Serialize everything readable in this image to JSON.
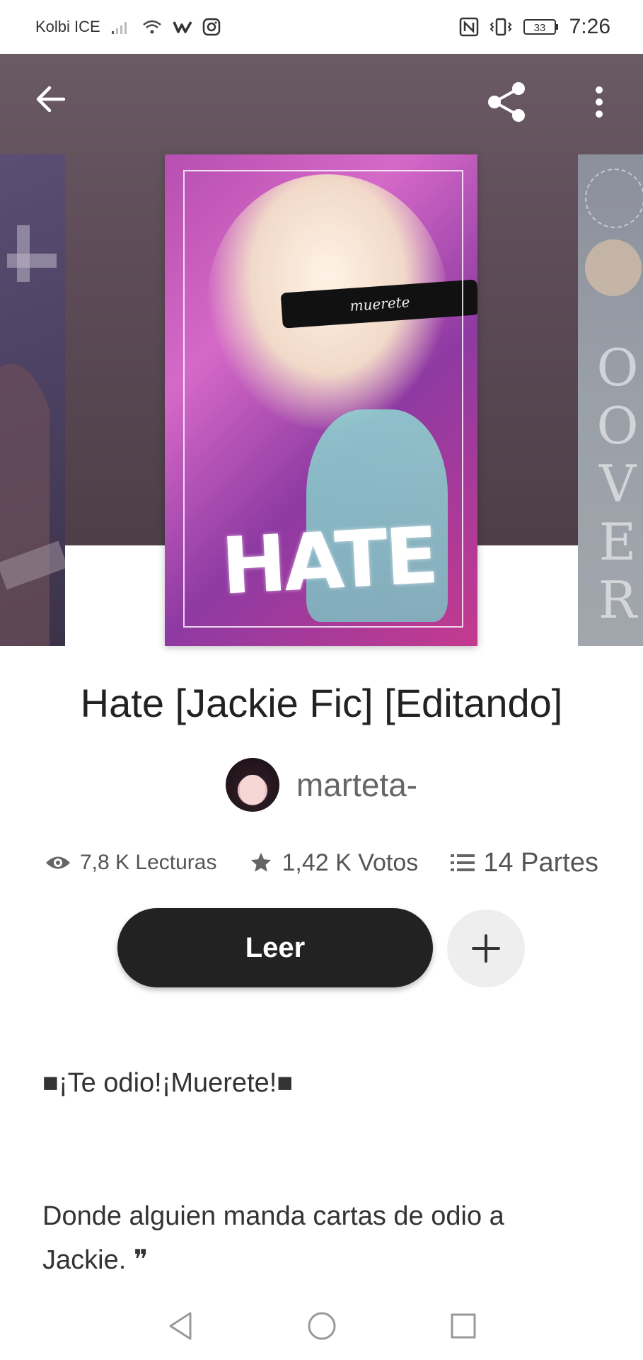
{
  "status_bar": {
    "carrier": "Kolbi ICE",
    "battery": "33",
    "time": "7:26"
  },
  "toolbar": {
    "back_icon": "arrow-left-icon",
    "share_icon": "share-icon",
    "more_icon": "more-vertical-icon"
  },
  "cover": {
    "art_caption": "muerete",
    "art_title": "HATE",
    "right_cover_letters": [
      "O",
      "O",
      "V",
      "E",
      "R"
    ]
  },
  "story": {
    "title": "Hate  [Jackie Fic] [Editando]",
    "author": "marteta-",
    "stats": {
      "reads": "7,8 K Lecturas",
      "votes": "1,42 K Votos",
      "parts": "14 Partes"
    },
    "read_label": "Leer",
    "description_line1": "■¡Te odio!¡Muerete!■",
    "description_line2": "Donde alguien manda cartas de odio a Jackie. ❞"
  },
  "colors": {
    "primary_button": "#222222",
    "secondary_button": "#eeeeee",
    "text": "#222222",
    "muted": "#666666"
  }
}
